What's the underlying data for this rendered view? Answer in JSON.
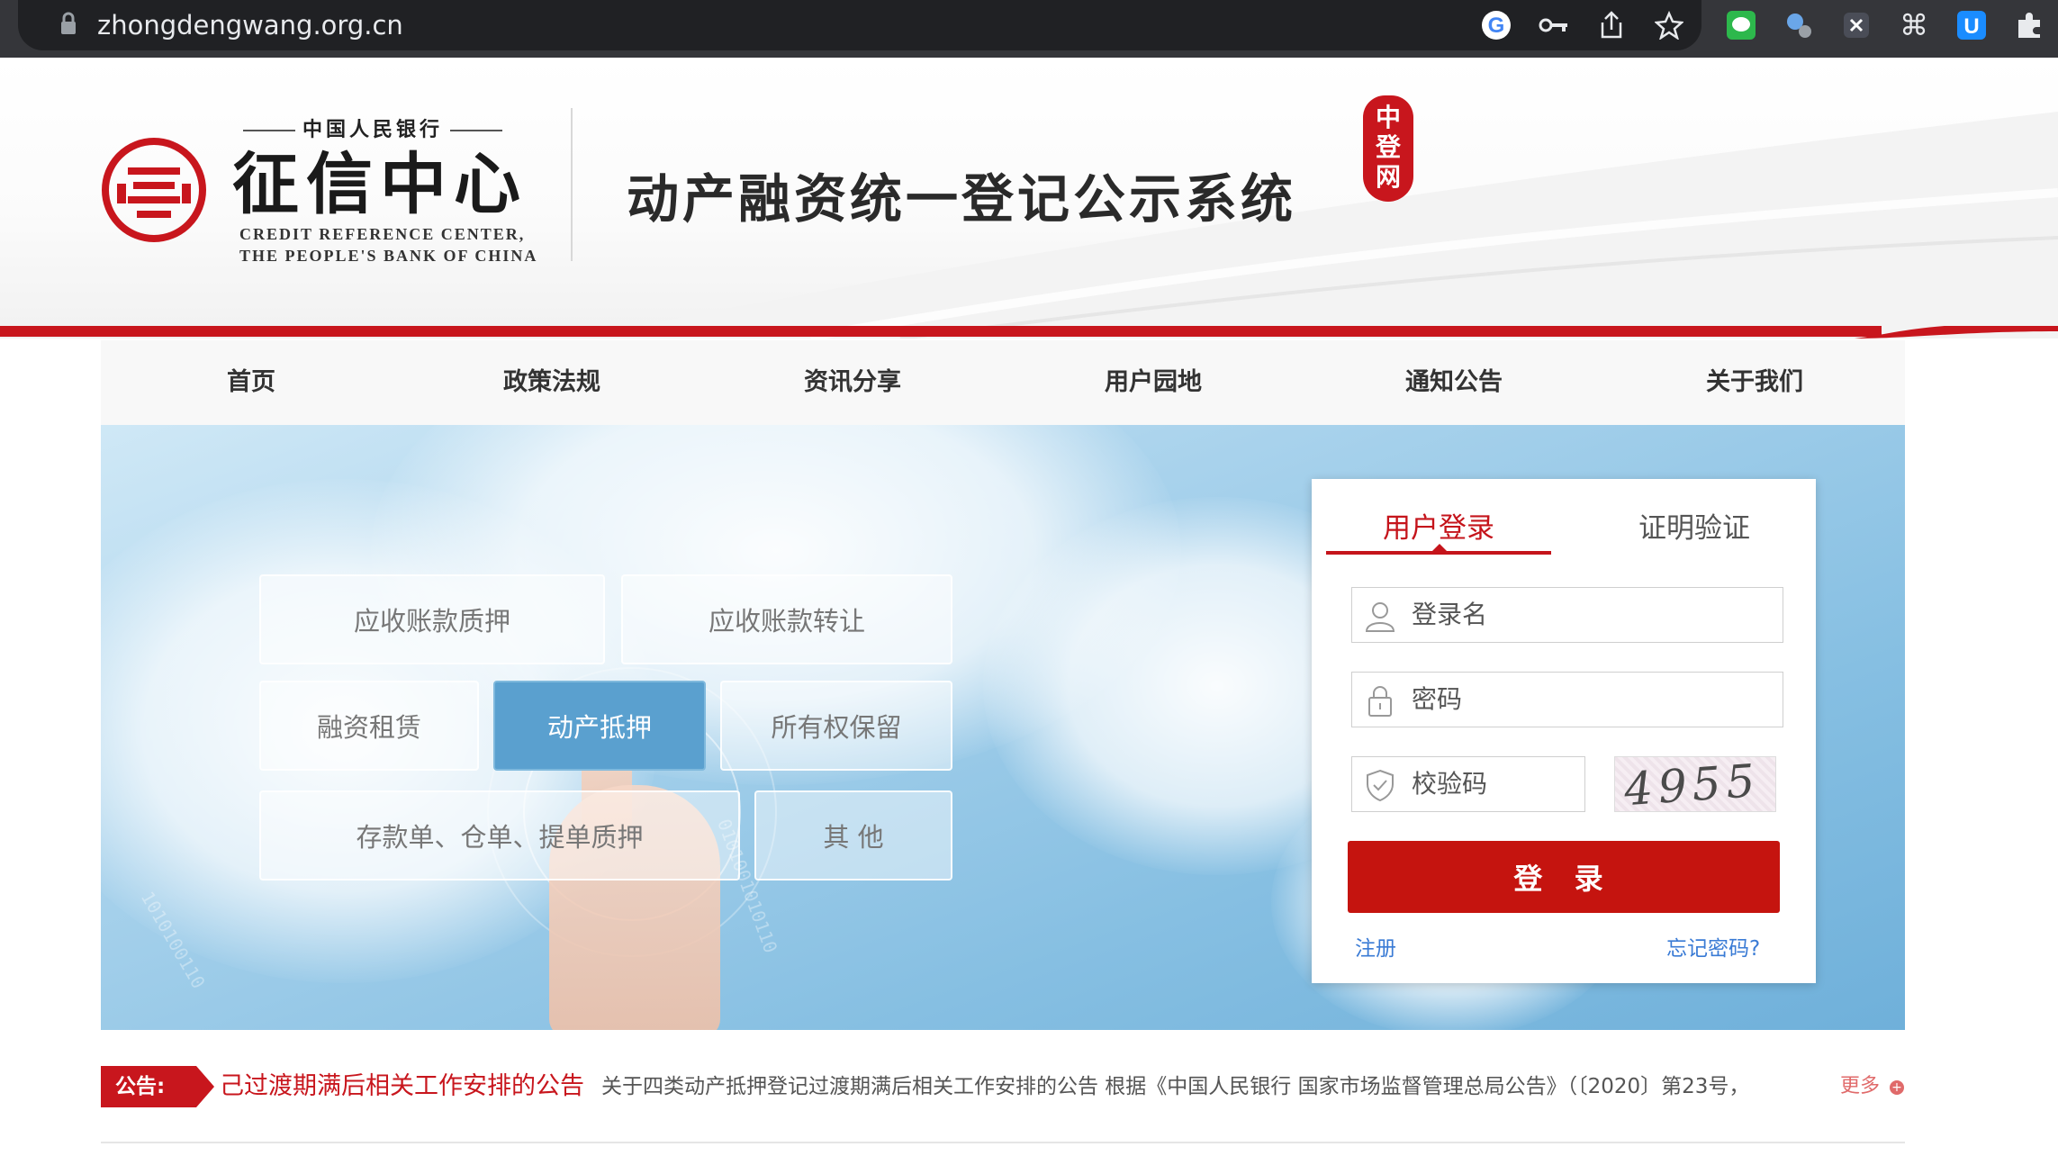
{
  "browser": {
    "url": "zhongdengwang.org.cn",
    "colors": {
      "toolbar": "#35363a",
      "omnibox": "#202124"
    },
    "icons": [
      "lock-icon",
      "google-icon",
      "key-icon",
      "share-icon",
      "star-icon",
      "chat-extension-icon",
      "search-extension-icon",
      "x-extension-icon",
      "command-icon",
      "u-extension-icon",
      "puzzle-icon"
    ]
  },
  "header": {
    "logo_top": "中国人民银行",
    "logo_main": "征信中心",
    "logo_en_1": "CREDIT REFERENCE CENTER,",
    "logo_en_2": "THE PEOPLE'S BANK OF CHINA",
    "system_title": "动产融资统一登记公示系统",
    "seal_chars": [
      "中",
      "登",
      "网"
    ],
    "brand_red": "#c8161d"
  },
  "nav": {
    "items": [
      {
        "label": "首页"
      },
      {
        "label": "政策法规"
      },
      {
        "label": "资讯分享"
      },
      {
        "label": "用户园地"
      },
      {
        "label": "通知公告"
      },
      {
        "label": "关于我们"
      }
    ]
  },
  "banner": {
    "tiles": [
      {
        "label": "应收账款质押",
        "active": false
      },
      {
        "label": "应收账款转让",
        "active": false
      },
      {
        "label": "融资租赁",
        "active": false
      },
      {
        "label": "动产抵押",
        "active": true
      },
      {
        "label": "所有权保留",
        "active": false
      },
      {
        "label": "存款单、仓单、提单质押",
        "active": false
      },
      {
        "label": "其  他",
        "active": false
      }
    ]
  },
  "login": {
    "tabs": [
      {
        "label": "用户登录",
        "selected": true
      },
      {
        "label": "证明验证",
        "selected": false
      }
    ],
    "username_placeholder": "登录名",
    "password_placeholder": "密码",
    "captcha_placeholder": "校验码",
    "captcha_image_text": "4955",
    "submit_label": "登 录",
    "register_link": "注册",
    "forgot_link": "忘记密码?",
    "button_color": "#c5140f",
    "link_color": "#3a7bd5"
  },
  "notice": {
    "label": "公告:",
    "title": "己过渡期满后相关工作安排的公告",
    "body": "关于四类动产抵押登记过渡期满后相关工作安排的公告 根据《中国人民银行 国家市场监督管理总局公告》（〔2020〕第23号，",
    "more": "更多"
  }
}
